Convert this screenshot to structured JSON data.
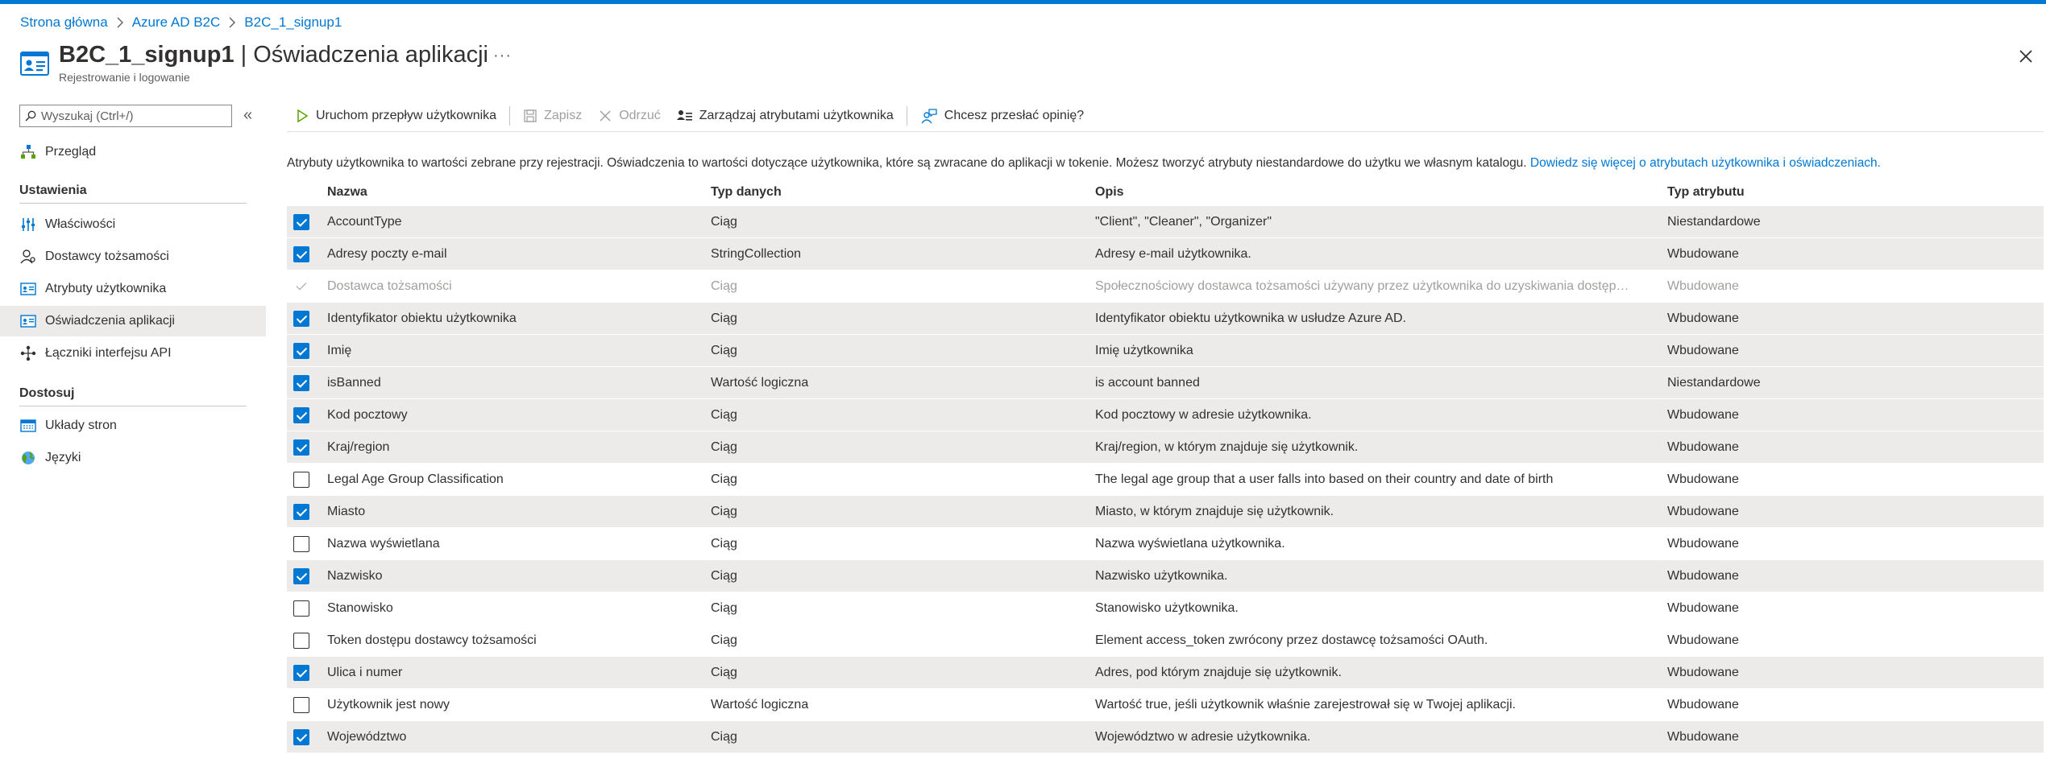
{
  "breadcrumb": [
    "Strona główna",
    "Azure AD B2C",
    "B2C_1_signup1"
  ],
  "header": {
    "title_main": "B2C_1_signup1",
    "title_sub": " | Oświadczenia aplikacji",
    "subtitle": "Rejestrowanie i logowanie",
    "more": "···"
  },
  "sidebar": {
    "search_placeholder": "Wyszukaj (Ctrl+/)",
    "collapse": "«",
    "overview": "Przegląd",
    "section_settings": "Ustawienia",
    "settings_items": [
      {
        "label": "Właściwości",
        "icon": "properties-icon"
      },
      {
        "label": "Dostawcy tożsamości",
        "icon": "identity-providers-icon"
      },
      {
        "label": "Atrybuty użytkownika",
        "icon": "user-attributes-icon"
      },
      {
        "label": "Oświadczenia aplikacji",
        "icon": "application-claims-icon"
      },
      {
        "label": "Łączniki interfejsu API",
        "icon": "api-connectors-icon"
      }
    ],
    "section_customize": "Dostosuj",
    "customize_items": [
      {
        "label": "Układy stron",
        "icon": "page-layouts-icon"
      },
      {
        "label": "Języki",
        "icon": "languages-icon"
      }
    ]
  },
  "toolbar": {
    "run": "Uruchom przepływ użytkownika",
    "save": "Zapisz",
    "discard": "Odrzuć",
    "manage": "Zarządzaj atrybutami użytkownika",
    "feedback": "Chcesz przesłać opinię?"
  },
  "description": {
    "text": "Atrybuty użytkownika to wartości zebrane przy rejestracji. Oświadczenia to wartości dotyczące użytkownika, które są zwracane do aplikacji w tokenie. Możesz tworzyć atrybuty niestandardowe do użytku we własnym katalogu. ",
    "link": "Dowiedz się więcej o atrybutach użytkownika i oświadczeniach."
  },
  "table": {
    "columns": [
      "Nazwa",
      "Typ danych",
      "Opis",
      "Typ atrybutu"
    ],
    "rows": [
      {
        "name": "AccountType",
        "type": "Ciąg",
        "desc": "\"Client\", \"Cleaner\", \"Organizer\"",
        "attr": "Niestandardowe",
        "checked": true,
        "disabled": false
      },
      {
        "name": "Adresy poczty e-mail",
        "type": "StringCollection",
        "desc": "Adresy e-mail użytkownika.",
        "attr": "Wbudowane",
        "checked": true,
        "disabled": false
      },
      {
        "name": "Dostawca tożsamości",
        "type": "Ciąg",
        "desc": "Społecznościowy dostawca tożsamości używany przez użytkownika do uzyskiwania dostępu do aplikacji.",
        "attr": "Wbudowane",
        "checked": true,
        "disabled": true
      },
      {
        "name": "Identyfikator obiektu użytkownika",
        "type": "Ciąg",
        "desc": "Identyfikator obiektu użytkownika w usłudze Azure AD.",
        "attr": "Wbudowane",
        "checked": true,
        "disabled": false
      },
      {
        "name": "Imię",
        "type": "Ciąg",
        "desc": "Imię użytkownika",
        "attr": "Wbudowane",
        "checked": true,
        "disabled": false
      },
      {
        "name": "isBanned",
        "type": "Wartość logiczna",
        "desc": "is account banned",
        "attr": "Niestandardowe",
        "checked": true,
        "disabled": false
      },
      {
        "name": "Kod pocztowy",
        "type": "Ciąg",
        "desc": "Kod pocztowy w adresie użytkownika.",
        "attr": "Wbudowane",
        "checked": true,
        "disabled": false
      },
      {
        "name": "Kraj/region",
        "type": "Ciąg",
        "desc": "Kraj/region, w którym znajduje się użytkownik.",
        "attr": "Wbudowane",
        "checked": true,
        "disabled": false
      },
      {
        "name": "Legal Age Group Classification",
        "type": "Ciąg",
        "desc": "The legal age group that a user falls into based on their country and date of birth",
        "attr": "Wbudowane",
        "checked": false,
        "disabled": false
      },
      {
        "name": "Miasto",
        "type": "Ciąg",
        "desc": "Miasto, w którym znajduje się użytkownik.",
        "attr": "Wbudowane",
        "checked": true,
        "disabled": false
      },
      {
        "name": "Nazwa wyświetlana",
        "type": "Ciąg",
        "desc": "Nazwa wyświetlana użytkownika.",
        "attr": "Wbudowane",
        "checked": false,
        "disabled": false
      },
      {
        "name": "Nazwisko",
        "type": "Ciąg",
        "desc": "Nazwisko użytkownika.",
        "attr": "Wbudowane",
        "checked": true,
        "disabled": false
      },
      {
        "name": "Stanowisko",
        "type": "Ciąg",
        "desc": "Stanowisko użytkownika.",
        "attr": "Wbudowane",
        "checked": false,
        "disabled": false
      },
      {
        "name": "Token dostępu dostawcy tożsamości",
        "type": "Ciąg",
        "desc": "Element access_token zwrócony przez dostawcę tożsamości OAuth.",
        "attr": "Wbudowane",
        "checked": false,
        "disabled": false
      },
      {
        "name": "Ulica i numer",
        "type": "Ciąg",
        "desc": "Adres, pod którym znajduje się użytkownik.",
        "attr": "Wbudowane",
        "checked": true,
        "disabled": false
      },
      {
        "name": "Użytkownik jest nowy",
        "type": "Wartość logiczna",
        "desc": "Wartość true, jeśli użytkownik właśnie zarejestrował się w Twojej aplikacji.",
        "attr": "Wbudowane",
        "checked": false,
        "disabled": false
      },
      {
        "name": "Województwo",
        "type": "Ciąg",
        "desc": "Województwo w adresie użytkownika.",
        "attr": "Wbudowane",
        "checked": true,
        "disabled": false
      }
    ]
  },
  "colors": {
    "accent": "#0078d4",
    "selected_row": "#edebe9",
    "text": "#323130",
    "muted": "#a19f9d"
  }
}
